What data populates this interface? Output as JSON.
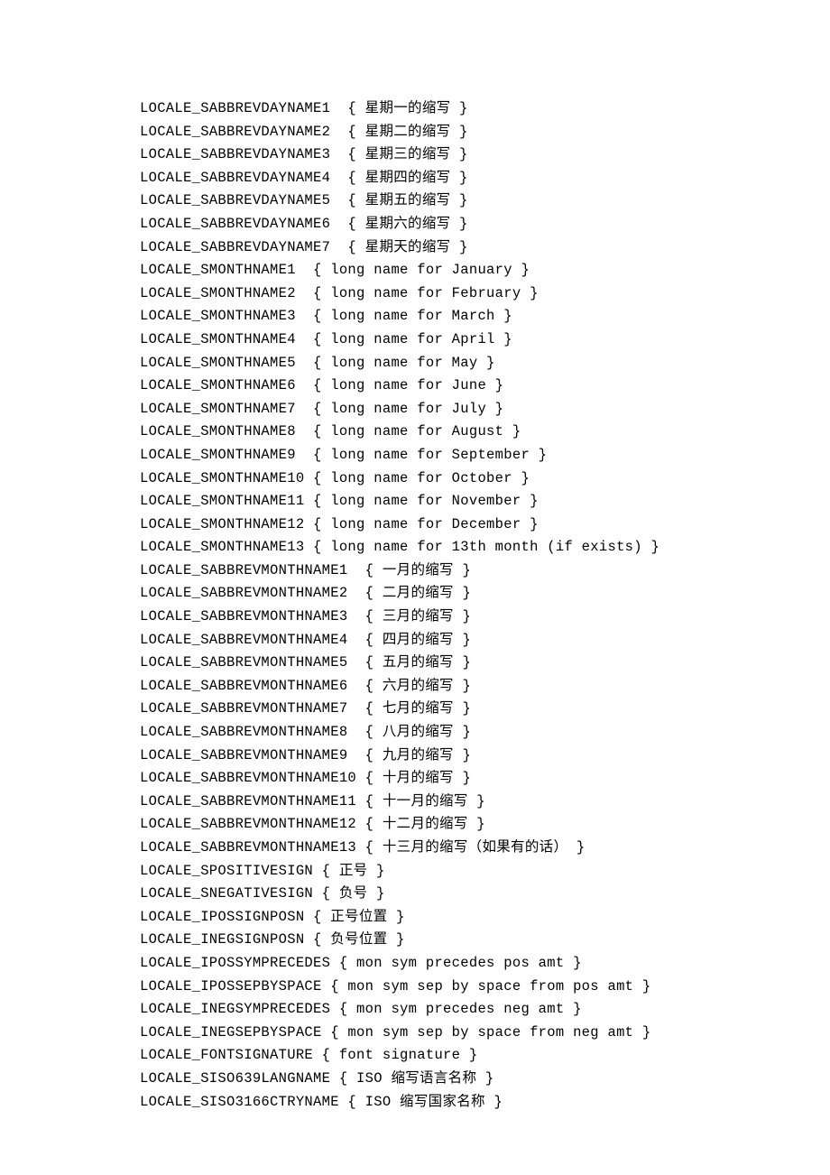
{
  "lines": [
    "LOCALE_SABBREVDAYNAME1  { 星期一的缩写 }",
    "LOCALE_SABBREVDAYNAME2  { 星期二的缩写 }",
    "LOCALE_SABBREVDAYNAME3  { 星期三的缩写 }",
    "LOCALE_SABBREVDAYNAME4  { 星期四的缩写 }",
    "LOCALE_SABBREVDAYNAME5  { 星期五的缩写 }",
    "LOCALE_SABBREVDAYNAME6  { 星期六的缩写 }",
    "LOCALE_SABBREVDAYNAME7  { 星期天的缩写 }",
    "LOCALE_SMONTHNAME1  { long name for January }",
    "LOCALE_SMONTHNAME2  { long name for February }",
    "LOCALE_SMONTHNAME3  { long name for March }",
    "LOCALE_SMONTHNAME4  { long name for April }",
    "LOCALE_SMONTHNAME5  { long name for May }",
    "LOCALE_SMONTHNAME6  { long name for June }",
    "LOCALE_SMONTHNAME7  { long name for July }",
    "LOCALE_SMONTHNAME8  { long name for August }",
    "LOCALE_SMONTHNAME9  { long name for September }",
    "LOCALE_SMONTHNAME10 { long name for October }",
    "LOCALE_SMONTHNAME11 { long name for November }",
    "LOCALE_SMONTHNAME12 { long name for December }",
    "LOCALE_SMONTHNAME13 { long name for 13th month (if exists) }",
    "LOCALE_SABBREVMONTHNAME1  { 一月的缩写 }",
    "LOCALE_SABBREVMONTHNAME2  { 二月的缩写 }",
    "LOCALE_SABBREVMONTHNAME3  { 三月的缩写 }",
    "LOCALE_SABBREVMONTHNAME4  { 四月的缩写 }",
    "LOCALE_SABBREVMONTHNAME5  { 五月的缩写 }",
    "LOCALE_SABBREVMONTHNAME6  { 六月的缩写 }",
    "LOCALE_SABBREVMONTHNAME7  { 七月的缩写 }",
    "LOCALE_SABBREVMONTHNAME8  { 八月的缩写 }",
    "LOCALE_SABBREVMONTHNAME9  { 九月的缩写 }",
    "LOCALE_SABBREVMONTHNAME10 { 十月的缩写 }",
    "LOCALE_SABBREVMONTHNAME11 { 十一月的缩写 }",
    "LOCALE_SABBREVMONTHNAME12 { 十二月的缩写 }",
    "LOCALE_SABBREVMONTHNAME13 { 十三月的缩写（如果有的话） }",
    "LOCALE_SPOSITIVESIGN { 正号 }",
    "LOCALE_SNEGATIVESIGN { 负号 }",
    "LOCALE_IPOSSIGNPOSN { 正号位置 }",
    "LOCALE_INEGSIGNPOSN { 负号位置 }",
    "LOCALE_IPOSSYMPRECEDES { mon sym precedes pos amt }",
    "LOCALE_IPOSSEPBYSPACE { mon sym sep by space from pos amt }",
    "LOCALE_INEGSYMPRECEDES { mon sym precedes neg amt }",
    "LOCALE_INEGSEPBYSPACE { mon sym sep by space from neg amt }",
    "LOCALE_FONTSIGNATURE { font signature }",
    "LOCALE_SISO639LANGNAME { ISO 缩写语言名称 }",
    "LOCALE_SISO3166CTRYNAME { ISO 缩写国家名称 }"
  ]
}
